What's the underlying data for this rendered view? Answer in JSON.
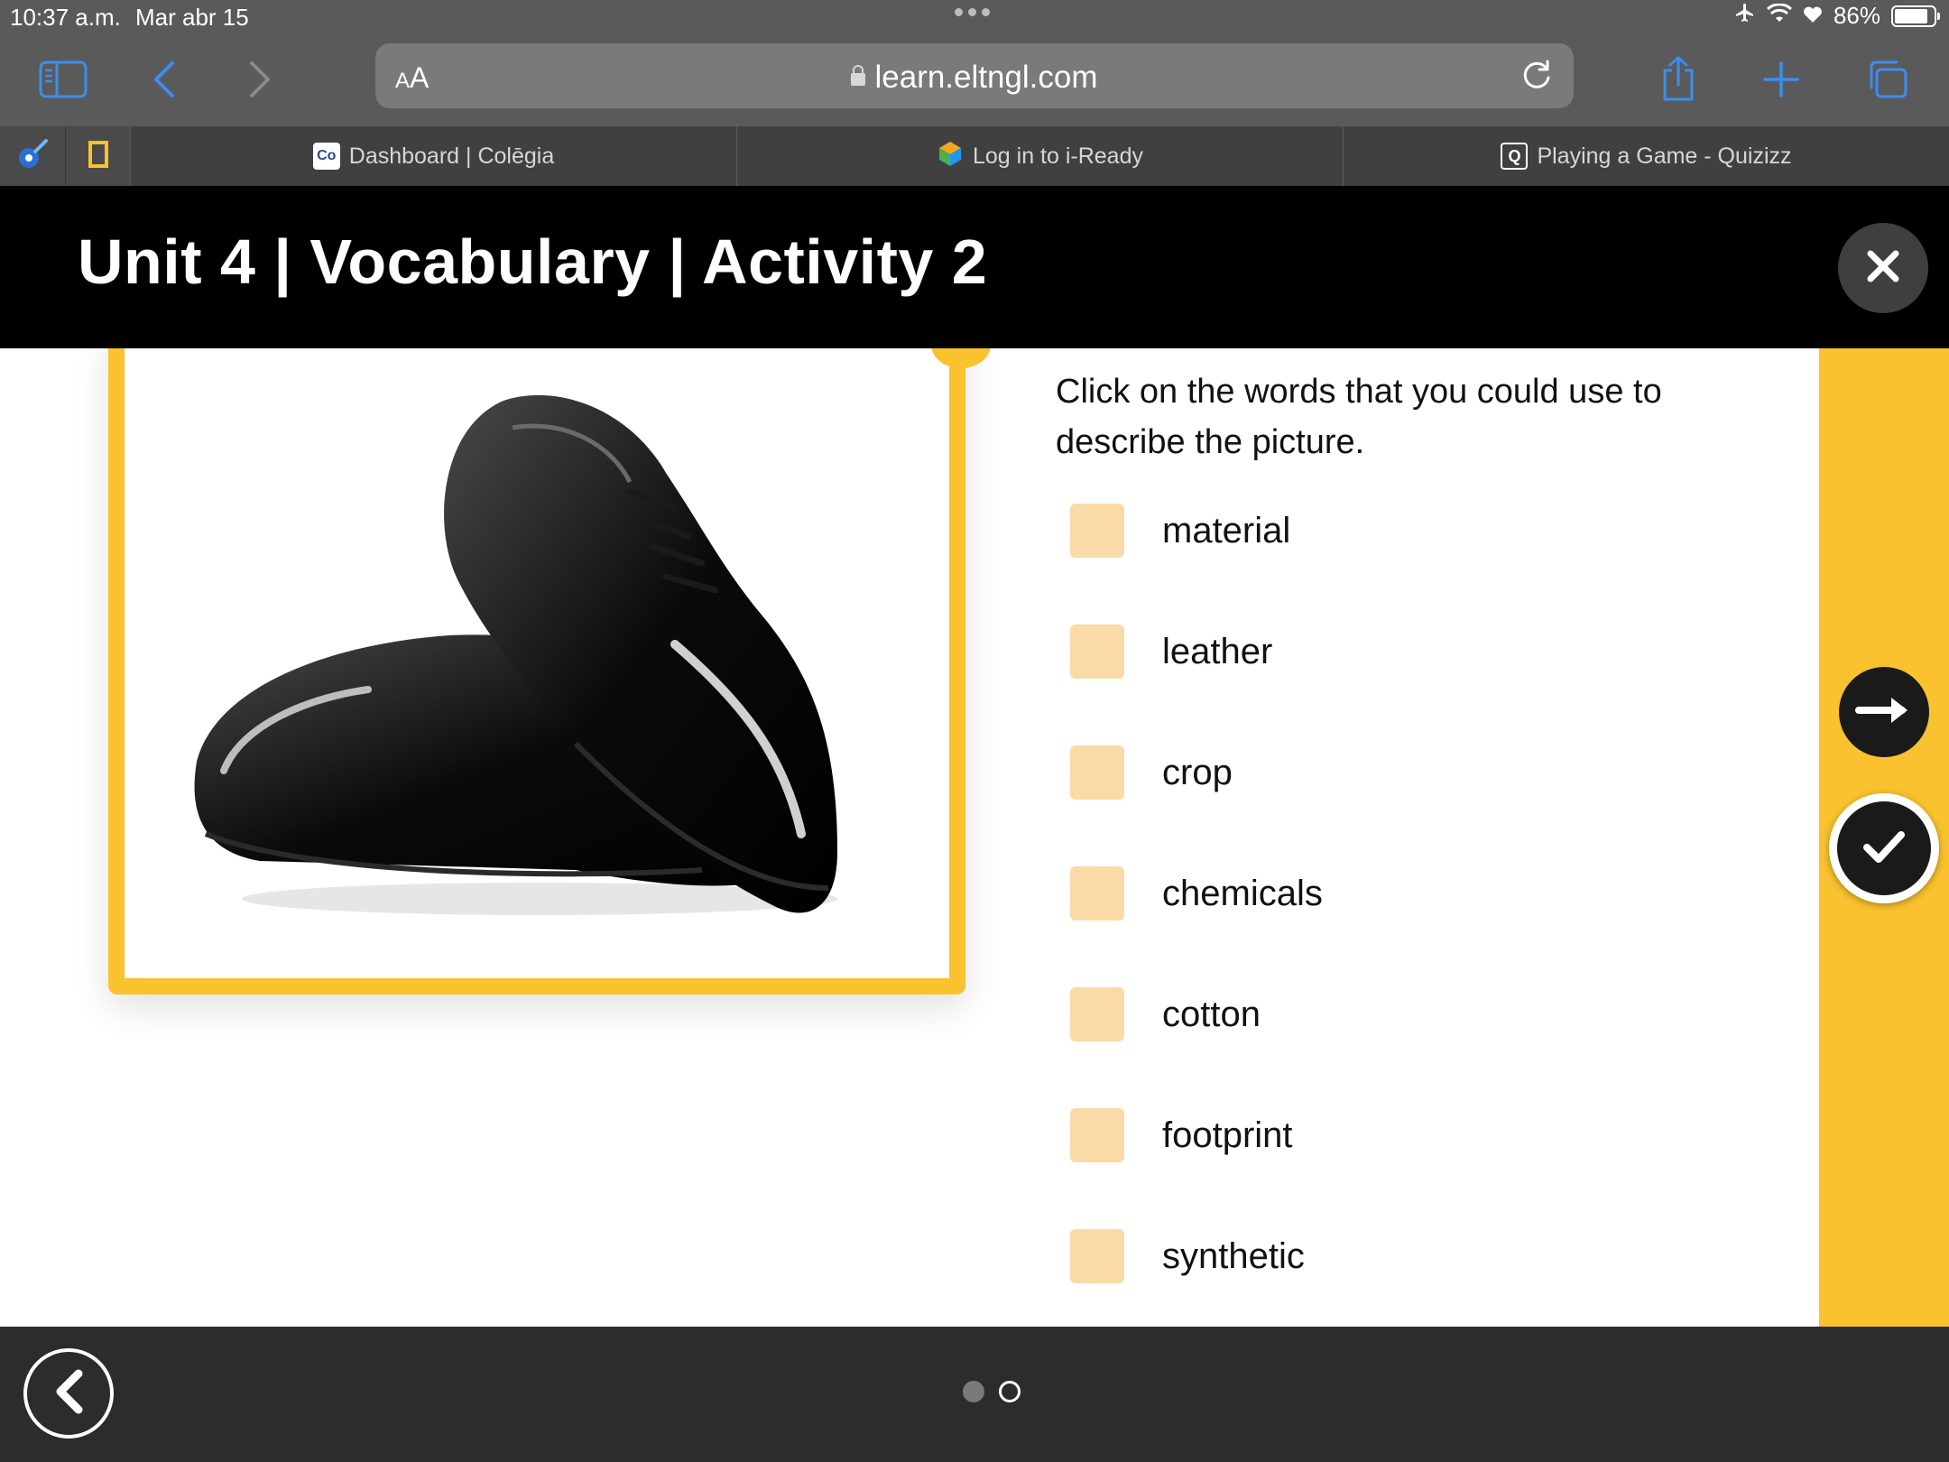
{
  "status_bar": {
    "time": "10:37 a.m.",
    "date": "Mar abr 15",
    "battery": "86%",
    "battery_level": 0.86
  },
  "browser": {
    "text_size_label": "AA",
    "url": "learn.eltngl.com",
    "accent_color": "#3b8ef0",
    "tabs": [
      {
        "label": "Dashboard | Colēgia",
        "icon": "colegia-favicon"
      },
      {
        "label": "Log in to i-Ready",
        "icon": "iready-cube-favicon"
      },
      {
        "label": "Playing a Game - Quizizz",
        "icon": "quizizz-favicon"
      }
    ]
  },
  "activity": {
    "title": "Unit 4 | Vocabulary | Activity 2",
    "instructions": "Click on the words that you could use to describe the picture.",
    "image_alt": "pair of black leather dress shoes",
    "options": [
      {
        "label": "material",
        "checked": false
      },
      {
        "label": "leather",
        "checked": false
      },
      {
        "label": "crop",
        "checked": false
      },
      {
        "label": "chemicals",
        "checked": false
      },
      {
        "label": "cotton",
        "checked": false
      },
      {
        "label": "footprint",
        "checked": false
      },
      {
        "label": "synthetic",
        "checked": false
      }
    ],
    "accent_color": "#f9c22e",
    "checkbox_color": "#fadaa6"
  },
  "pagination": {
    "current": 2,
    "total": 2
  }
}
